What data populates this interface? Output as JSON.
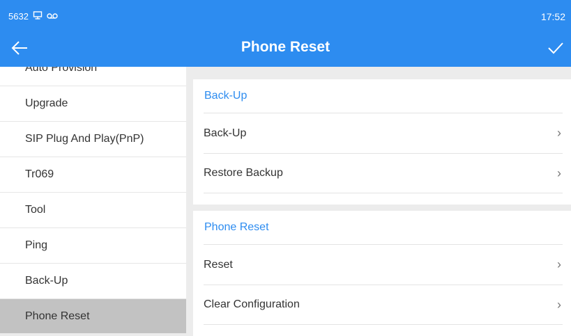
{
  "status_bar": {
    "extension": "5632",
    "time": "17:52"
  },
  "header": {
    "title": "Phone Reset"
  },
  "sidebar": {
    "items": [
      {
        "label": "Auto Provision"
      },
      {
        "label": "Upgrade"
      },
      {
        "label": "SIP Plug And Play(PnP)"
      },
      {
        "label": "Tr069"
      },
      {
        "label": "Tool"
      },
      {
        "label": "Ping"
      },
      {
        "label": "Back-Up"
      },
      {
        "label": "Phone Reset",
        "selected": true
      }
    ]
  },
  "sections": [
    {
      "title": "Back-Up",
      "rows": [
        {
          "label": "Back-Up"
        },
        {
          "label": "Restore Backup"
        }
      ]
    },
    {
      "title": "Phone Reset",
      "rows": [
        {
          "label": "Reset"
        },
        {
          "label": "Clear Configuration"
        }
      ]
    }
  ],
  "colors": {
    "accent": "#2d8cf0",
    "selected_item": "#c2c2c2"
  }
}
